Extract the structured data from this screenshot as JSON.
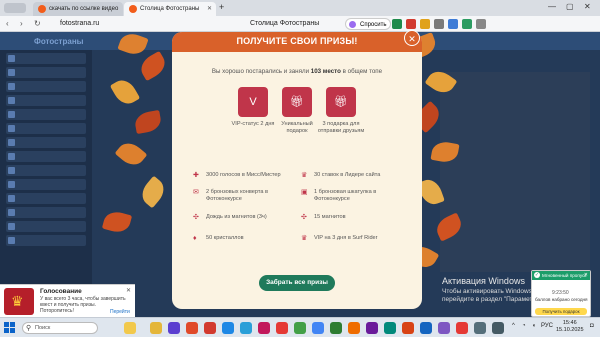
{
  "browser": {
    "tabs": [
      {
        "label": "скачать по ссылке видео"
      },
      {
        "label": "Столица Фотостраны"
      }
    ],
    "url": "fotostrana.ru",
    "page_title": "Столица Фотостраны",
    "ask_button": "Спросить"
  },
  "site": {
    "logo": "Фотостраны"
  },
  "modal": {
    "title": "ПОЛУЧИТЕ СВОИ ПРИЗЫ!",
    "subtitle_pre": "Вы хорошо постарались и заняли",
    "subtitle_rank": "103 место",
    "subtitle_post": "в общем топе",
    "prizes": [
      {
        "icon": "vip-icon",
        "label": "VIP-статус 2 дня"
      },
      {
        "icon": "gift-icon",
        "label": "Уникальный подарок"
      },
      {
        "icon": "gift-icon",
        "label": "3 подарка для отправки друзьям"
      }
    ],
    "rewards_left": [
      {
        "icon": "star-icon",
        "label": "3000 голосов в Мисс/Мистер"
      },
      {
        "icon": "envelope-icon",
        "label": "2 бронзовых конверта в Фотоконкурсе"
      },
      {
        "icon": "magnet-icon",
        "label": "Дождь из магнитов (3ч)"
      },
      {
        "icon": "crystal-icon",
        "label": "50 кристаллов"
      }
    ],
    "rewards_right": [
      {
        "icon": "crown-icon",
        "label": "30 ставок в Лидере сайта"
      },
      {
        "icon": "box-icon",
        "label": "1 бронзовая шкатулка в Фотоконкурсе"
      },
      {
        "icon": "magnet-icon",
        "label": "15 магнитов"
      },
      {
        "icon": "crown-icon",
        "label": "VIP на 3 дня в Surf Rider"
      }
    ],
    "button": "Забрать все призы"
  },
  "activation": {
    "title": "Активация Windows",
    "text": "Чтобы активировать Windows, перейдите в раздел \"Параметры\"."
  },
  "notification_left": {
    "title": "Голосование",
    "text": "У вас всего 3 часа, чтобы завершить квест и получить призы. Поторопитесь!",
    "link": "Перейти"
  },
  "notification_right": {
    "header": "Мгновенный пропуск заданий",
    "timer": "9:23:50",
    "text": "баллов набрано сегодня",
    "button": "Получить подарок"
  },
  "taskbar": {
    "search_placeholder": "Поиск",
    "lang": "РУС",
    "time": "15:46",
    "date": "15.10.2025"
  },
  "colors": {
    "accent": "#d9612a",
    "prize_tile": "#c0354a",
    "button": "#1f7a5b",
    "modal_bg": "#fbf3e2"
  }
}
